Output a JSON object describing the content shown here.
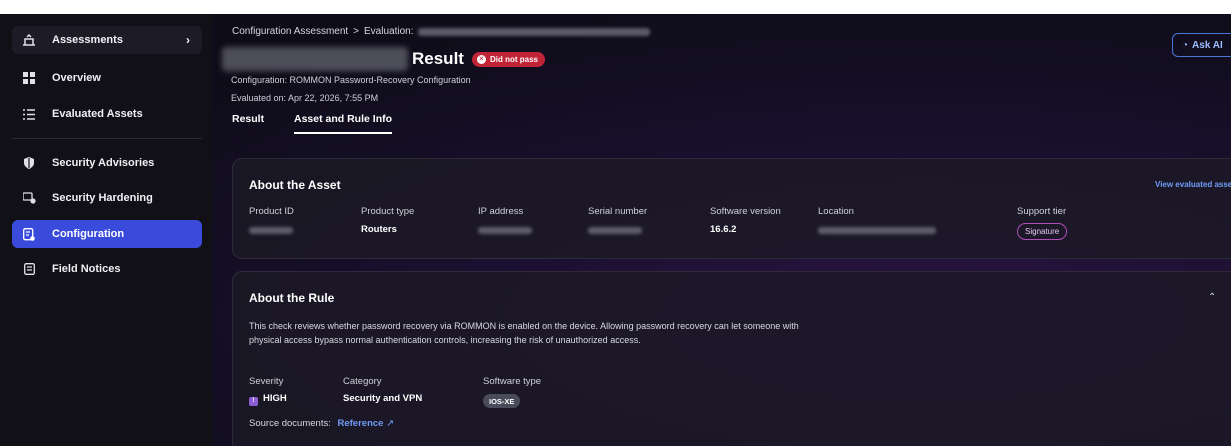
{
  "sidebar": {
    "items": [
      {
        "label": "Assessments",
        "icon": "assessments-icon"
      },
      {
        "label": "Overview",
        "icon": "overview-icon"
      },
      {
        "label": "Evaluated Assets",
        "icon": "list-icon"
      },
      {
        "label": "Security Advisories",
        "icon": "shield-icon"
      },
      {
        "label": "Security Hardening",
        "icon": "hardening-icon"
      },
      {
        "label": "Configuration",
        "icon": "configuration-icon"
      },
      {
        "label": "Field Notices",
        "icon": "notice-icon"
      }
    ],
    "active": "Configuration"
  },
  "header": {
    "breadcrumb_root": "Configuration Assessment",
    "breadcrumb_sep": ">",
    "breadcrumb_eval": "Evaluation:",
    "title": "Result",
    "status_badge": "Did not pass",
    "configuration": "Configuration: ROMMON Password-Recovery Configuration",
    "evaluated_on": "Evaluated on: Apr 22, 2026, 7:55 PM",
    "ask_ai": "Ask AI"
  },
  "tabs": [
    {
      "label": "Result",
      "active": false
    },
    {
      "label": "Asset and Rule Info",
      "active": true
    }
  ],
  "asset": {
    "title": "About the Asset",
    "view_link": "View evaluated asset",
    "fields": {
      "product_id": "Product ID",
      "product_type": "Product type",
      "ip_address": "IP address",
      "serial_number": "Serial number",
      "software_version": "Software version",
      "location": "Location",
      "support_tier": "Support tier"
    },
    "values": {
      "product_type": "Routers",
      "software_version": "16.6.2",
      "support_tier": "Signature"
    }
  },
  "rule": {
    "title": "About the Rule",
    "description": "This check reviews whether password recovery via ROMMON is enabled on the device. Allowing password recovery can let someone with physical access bypass normal authentication controls, increasing the risk of unauthorized access.",
    "severity_label": "Severity",
    "severity_value": "HIGH",
    "category_label": "Category",
    "category_value": "Security and VPN",
    "software_type_label": "Software type",
    "software_type_value": "IOS-XE",
    "source_label": "Source documents:",
    "source_link": "Reference"
  },
  "colors": {
    "accent": "#3a4bdc",
    "fail": "#c22437",
    "link": "#6f9cf5",
    "severity_high": "#8e5dd6",
    "signature": "#b04db8"
  }
}
